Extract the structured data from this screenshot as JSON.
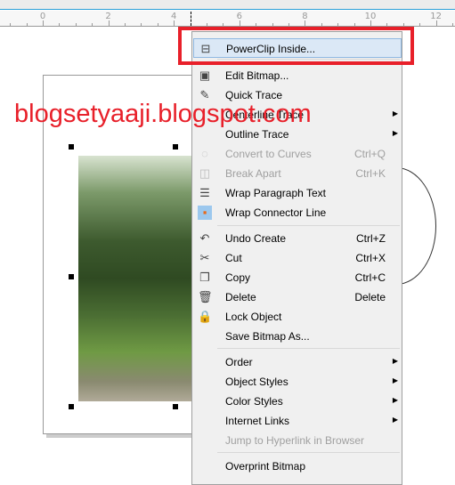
{
  "ruler": {
    "labels": [
      "0",
      "2",
      "4",
      "6",
      "8",
      "10",
      "12"
    ]
  },
  "watermark": "blogsetyaaji.blogspot.com",
  "menu": {
    "items": [
      {
        "label": "PowerClip Inside...",
        "icon": "powerclip-icon",
        "highlighted": true
      },
      {
        "label": "Edit Bitmap...",
        "icon": "edit-bitmap-icon"
      },
      {
        "label": "Quick Trace",
        "icon": "quick-trace-icon"
      },
      {
        "label": "Centerline Trace",
        "submenu": true
      },
      {
        "label": "Outline Trace",
        "submenu": true
      },
      {
        "label": "Convert to Curves",
        "shortcut": "Ctrl+Q",
        "disabled": true,
        "icon": "convert-curves-icon"
      },
      {
        "label": "Break Apart",
        "shortcut": "Ctrl+K",
        "disabled": true,
        "icon": "break-apart-icon"
      },
      {
        "label": "Wrap Paragraph Text",
        "icon": "wrap-text-icon"
      },
      {
        "label": "Wrap Connector Line",
        "icon": "wrap-connector-icon"
      },
      {
        "label": "Undo Create",
        "shortcut": "Ctrl+Z",
        "icon": "undo-icon"
      },
      {
        "label": "Cut",
        "shortcut": "Ctrl+X",
        "icon": "scissors-icon"
      },
      {
        "label": "Copy",
        "shortcut": "Ctrl+C",
        "icon": "copy-icon"
      },
      {
        "label": "Delete",
        "shortcut": "Delete",
        "icon": "trash-icon"
      },
      {
        "label": "Lock Object",
        "icon": "lock-icon"
      },
      {
        "label": "Save Bitmap As..."
      },
      {
        "label": "Order",
        "submenu": true
      },
      {
        "label": "Object Styles",
        "submenu": true
      },
      {
        "label": "Color Styles",
        "submenu": true
      },
      {
        "label": "Internet Links",
        "submenu": true
      },
      {
        "label": "Jump to Hyperlink in Browser",
        "disabled": true
      },
      {
        "label": "Overprint Bitmap"
      }
    ]
  },
  "colors": {
    "highlight_box": "#e8202a",
    "menu_highlight": "#dbe8f6"
  }
}
